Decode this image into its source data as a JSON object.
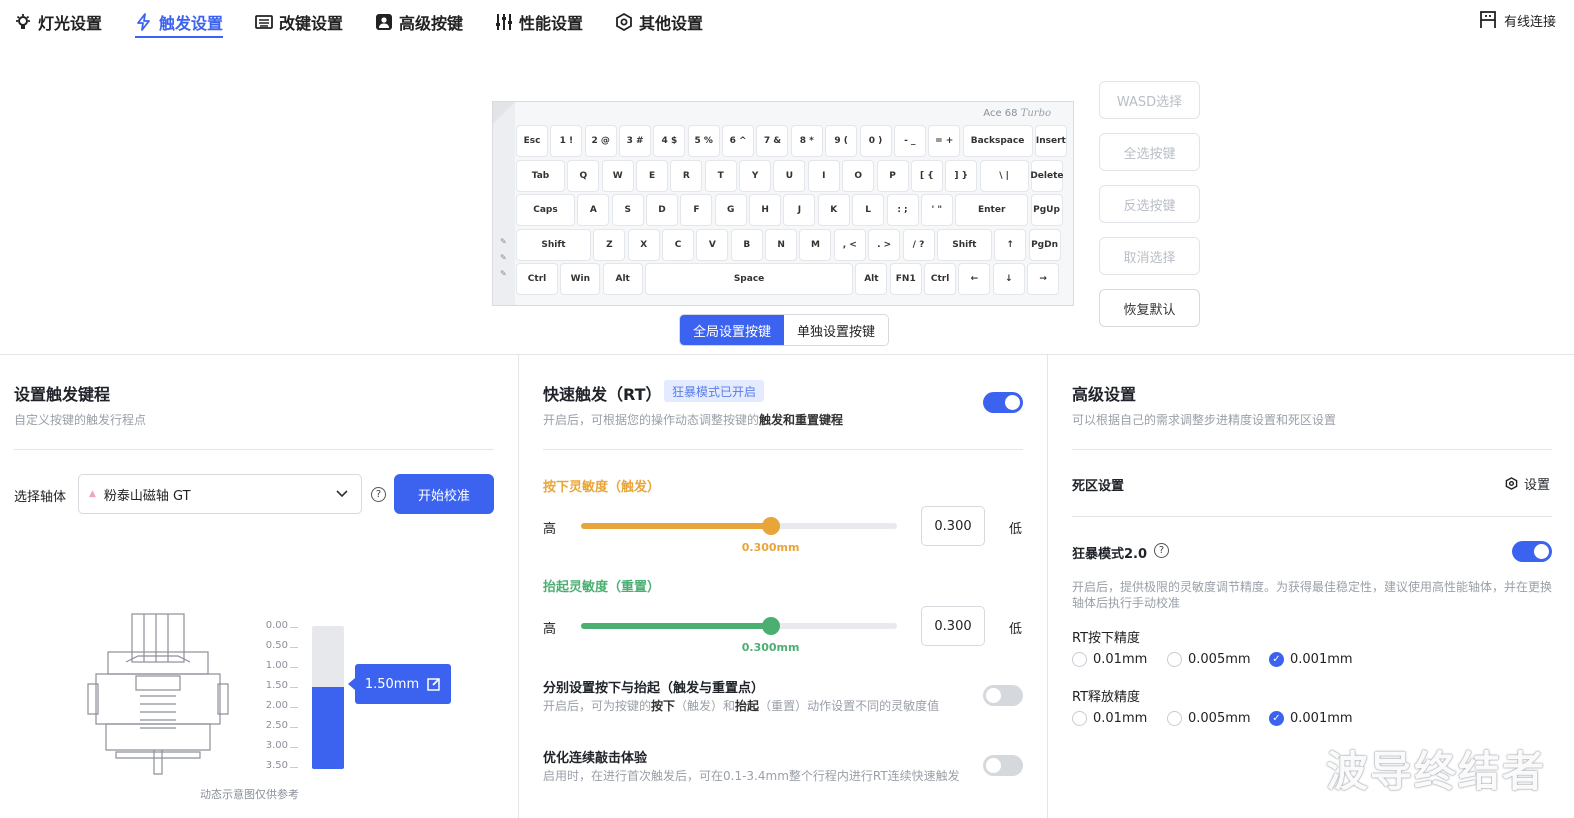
{
  "nav": {
    "items": [
      {
        "label": "灯光设置",
        "icon": "bulb-icon"
      },
      {
        "label": "触发设置",
        "icon": "lightning-icon"
      },
      {
        "label": "改键设置",
        "icon": "keyboard-icon"
      },
      {
        "label": "高级按键",
        "icon": "person-key-icon"
      },
      {
        "label": "性能设置",
        "icon": "sliders-icon"
      },
      {
        "label": "其他设置",
        "icon": "hexagon-gear-icon"
      }
    ],
    "active_index": 1,
    "connection": "有线连接",
    "connection_icon": "wired-connection-icon"
  },
  "keyboard": {
    "brand": "Ace 68",
    "brand_script": "Turbo",
    "rows": [
      [
        "Esc",
        "1 !",
        "2 @",
        "3 #",
        "4 $",
        "5 %",
        "6 ^",
        "7 &",
        "8 *",
        "9 (",
        "0 )",
        "- _",
        "= +",
        "Backspace",
        "Insert"
      ],
      [
        "Tab",
        "Q",
        "W",
        "E",
        "R",
        "T",
        "Y",
        "U",
        "I",
        "O",
        "P",
        "[ {",
        "] }",
        "\\ |",
        "Delete"
      ],
      [
        "Caps",
        "A",
        "S",
        "D",
        "F",
        "G",
        "H",
        "J",
        "K",
        "L",
        ": ;",
        "' \"",
        "Enter",
        "PgUp"
      ],
      [
        "Shift",
        "Z",
        "X",
        "C",
        "V",
        "B",
        "N",
        "M",
        ", <",
        ". >",
        "/ ?",
        "Shift",
        "↑",
        "PgDn"
      ],
      [
        "Ctrl",
        "Win",
        "Alt",
        "Space",
        "Alt",
        "FN1",
        "Ctrl",
        "←",
        "↓",
        "→"
      ]
    ]
  },
  "side_buttons": [
    "WASD选择",
    "全选按键",
    "反选按键",
    "取消选择",
    "恢复默认"
  ],
  "segment": {
    "global": "全局设置按键",
    "single": "单独设置按键"
  },
  "left_panel": {
    "title": "设置触发键程",
    "subtitle": "自定义按键的触发行程点",
    "axis_label": "选择轴体",
    "axis_value": "粉泰山磁轴 GT",
    "calibrate": "开始校准",
    "scale": [
      "0.00",
      "0.50",
      "1.00",
      "1.50",
      "2.00",
      "2.50",
      "3.00",
      "3.50"
    ],
    "travel_value": "1.50mm",
    "travel_fraction": 0.4286,
    "caption": "动态示意图仅供参考"
  },
  "mid_panel": {
    "title": "快速触发（RT）",
    "badge": "狂暴模式已开启",
    "enabled": true,
    "subtitle_pre": "开启后，可根据您的操作动态调整按键的",
    "subtitle_bold": "触发和重置键程",
    "press": {
      "title": "按下灵敏度（触发）",
      "high": "高",
      "low": "低",
      "display": "0.300mm",
      "value": "0.300",
      "fraction": 0.6,
      "color": "#e8a53a"
    },
    "release": {
      "title": "抬起灵敏度（重置）",
      "high": "高",
      "low": "低",
      "display": "0.300mm",
      "value": "0.300",
      "fraction": 0.6,
      "color": "#4caf72"
    },
    "separate": {
      "title": "分别设置按下与抬起（触发与重置点）",
      "desc_1": "开启后，可为按键的",
      "desc_b1": "按下",
      "desc_2": "（触发）和",
      "desc_b2": "抬起",
      "desc_3": "（重置）动作设置不同的灵敏度值",
      "enabled": false
    },
    "optimize": {
      "title": "优化连续敲击体验",
      "desc": "启用时，在进行首次触发后，可在0.1-3.4mm整个行程内进行RT连续快速触发",
      "enabled": false
    }
  },
  "right_panel": {
    "title": "高级设置",
    "subtitle": "可以根据自己的需求调整步进精度设置和死区设置",
    "deadzone": "死区设置",
    "deadzone_action": "设置",
    "berserk_title": "狂暴模式2.0",
    "berserk_enabled": true,
    "berserk_desc_1": "开启后，提供极限的灵敏度调节精度。为获得最佳稳定性，建议使用高性能轴体，并在更换",
    "berserk_desc_2": "轴体后执行手动校准",
    "press_precision": {
      "label": "RT按下精度",
      "options": [
        "0.01mm",
        "0.005mm",
        "0.001mm"
      ],
      "selected": 2
    },
    "release_precision": {
      "label": "RT释放精度",
      "options": [
        "0.01mm",
        "0.005mm",
        "0.001mm"
      ],
      "selected": 2
    }
  },
  "watermark": "波导终结者",
  "colors": {
    "accent": "#3b63f0",
    "press": "#e8a53a",
    "release": "#4caf72"
  }
}
